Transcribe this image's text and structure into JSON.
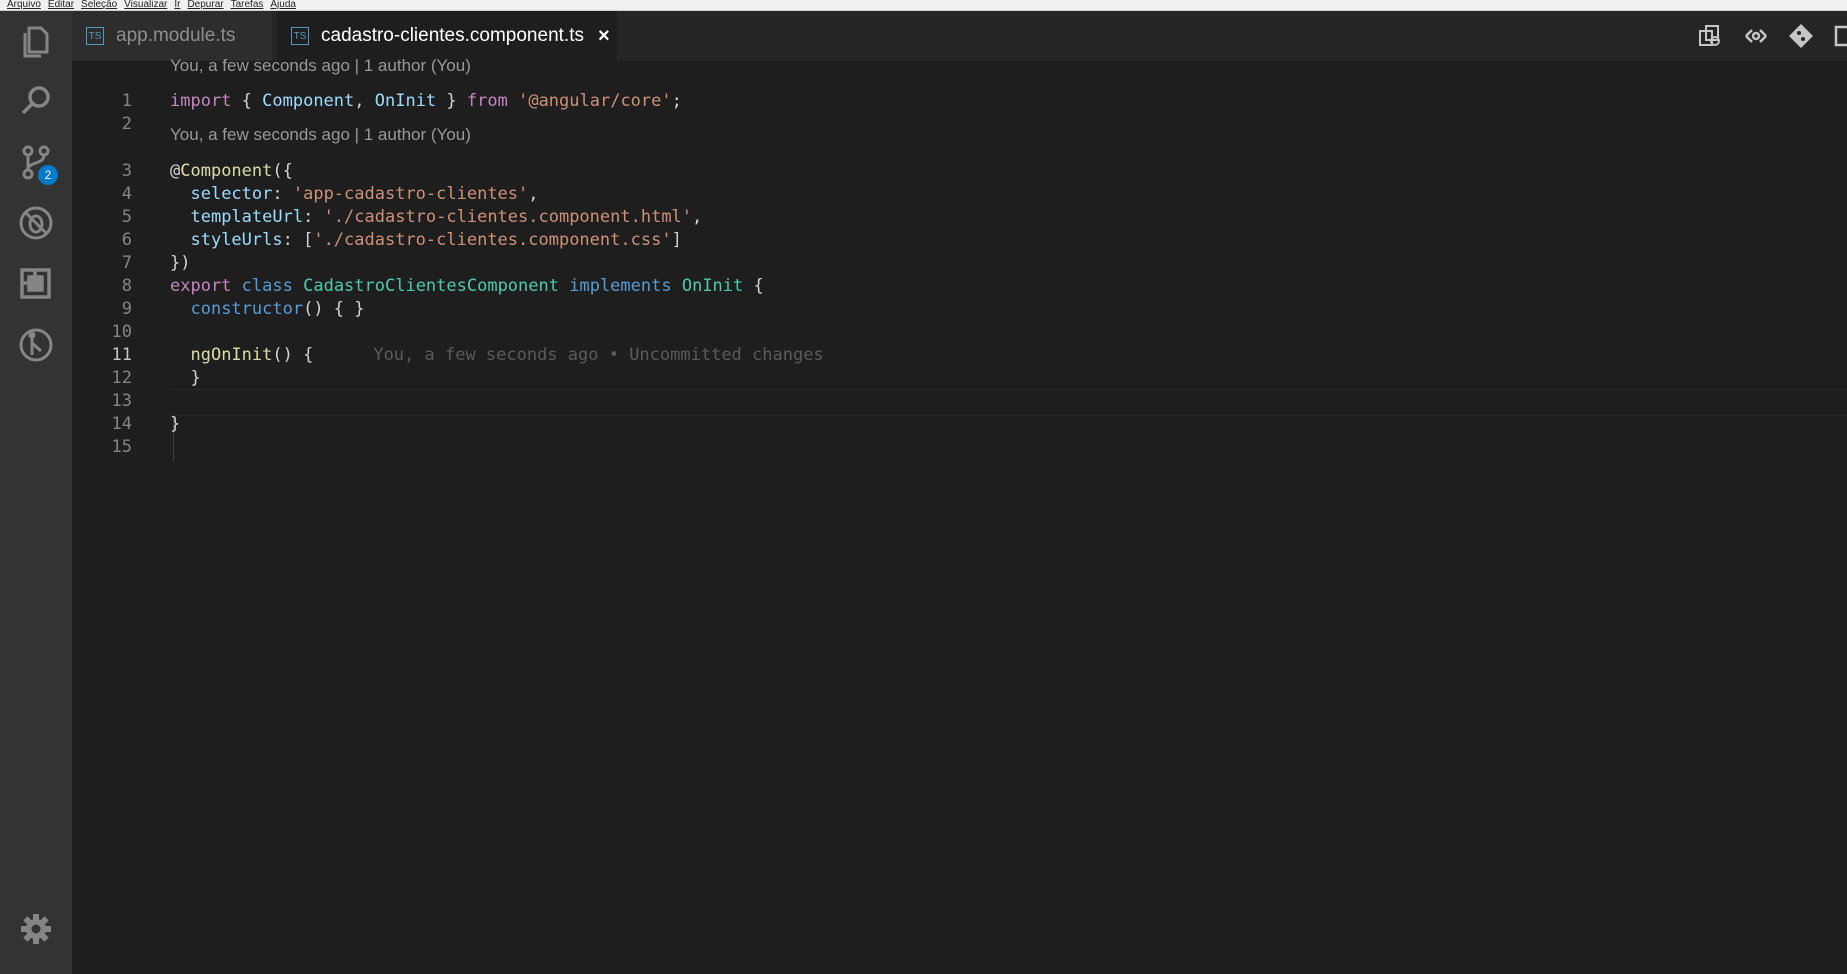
{
  "menu": [
    "Arquivo",
    "Editar",
    "Seleção",
    "Visualizar",
    "Ir",
    "Depurar",
    "Tarefas",
    "Ajuda"
  ],
  "activity_bar": {
    "items": [
      {
        "name": "explorer-icon"
      },
      {
        "name": "search-icon"
      },
      {
        "name": "source-control-icon",
        "badge": "2"
      },
      {
        "name": "debug-icon"
      },
      {
        "name": "extensions-icon"
      },
      {
        "name": "git-history-icon"
      }
    ],
    "settings": "gear-icon"
  },
  "tabs": [
    {
      "label": "app.module.ts",
      "icon": "TS",
      "active": false
    },
    {
      "label": "cadastro-clientes.component.ts",
      "icon": "TS",
      "active": true,
      "close": "×"
    }
  ],
  "toolbar": [
    "open-changes-icon",
    "toggle-blame-icon",
    "git-compare-icon",
    "split-editor-icon"
  ],
  "editor": {
    "codelens": [
      {
        "before_line": 1,
        "text": "You, a few seconds ago | 1 author (You)"
      },
      {
        "before_line": 3,
        "text": "You, a few seconds ago | 1 author (You)"
      }
    ],
    "line_numbers": [
      "1",
      "2",
      "3",
      "4",
      "5",
      "6",
      "7",
      "8",
      "9",
      "10",
      "11",
      "12",
      "13",
      "14",
      "15"
    ],
    "active_line": 11,
    "lines": [
      [
        {
          "t": "import",
          "c": "kw"
        },
        {
          "t": " { "
        },
        {
          "t": "Component",
          "c": "prop"
        },
        {
          "t": ", "
        },
        {
          "t": "OnInit",
          "c": "prop"
        },
        {
          "t": " } "
        },
        {
          "t": "from",
          "c": "kw"
        },
        {
          "t": " "
        },
        {
          "t": "'@angular/core'",
          "c": "str"
        },
        {
          "t": ";"
        }
      ],
      [],
      [
        {
          "t": "@",
          "c": ""
        },
        {
          "t": "Component",
          "c": "fn"
        },
        {
          "t": "({"
        }
      ],
      [
        {
          "t": "  "
        },
        {
          "t": "selector",
          "c": "prop"
        },
        {
          "t": ": "
        },
        {
          "t": "'app-cadastro-clientes'",
          "c": "str"
        },
        {
          "t": ","
        }
      ],
      [
        {
          "t": "  "
        },
        {
          "t": "templateUrl",
          "c": "prop"
        },
        {
          "t": ": "
        },
        {
          "t": "'./cadastro-clientes.component.html'",
          "c": "str"
        },
        {
          "t": ","
        }
      ],
      [
        {
          "t": "  "
        },
        {
          "t": "styleUrls",
          "c": "prop"
        },
        {
          "t": ": ["
        },
        {
          "t": "'./cadastro-clientes.component.css'",
          "c": "str"
        },
        {
          "t": "]"
        }
      ],
      [
        {
          "t": "})"
        }
      ],
      [
        {
          "t": "export",
          "c": "kw"
        },
        {
          "t": " "
        },
        {
          "t": "class",
          "c": "kwb"
        },
        {
          "t": " "
        },
        {
          "t": "CadastroClientesComponent",
          "c": "cls"
        },
        {
          "t": " "
        },
        {
          "t": "implements",
          "c": "kwb"
        },
        {
          "t": " "
        },
        {
          "t": "OnInit",
          "c": "cls"
        },
        {
          "t": " {"
        }
      ],
      [
        {
          "t": "  "
        },
        {
          "t": "constructor",
          "c": "kwb"
        },
        {
          "t": "() { }"
        }
      ],
      [],
      [
        {
          "t": "  "
        },
        {
          "t": "ngOnInit",
          "c": "fn"
        },
        {
          "t": "() {"
        },
        {
          "t": "You, a few seconds ago • Uncommitted changes",
          "c": "blame"
        }
      ],
      [
        {
          "t": "  }"
        }
      ],
      [],
      [
        {
          "t": "}"
        }
      ],
      []
    ]
  }
}
